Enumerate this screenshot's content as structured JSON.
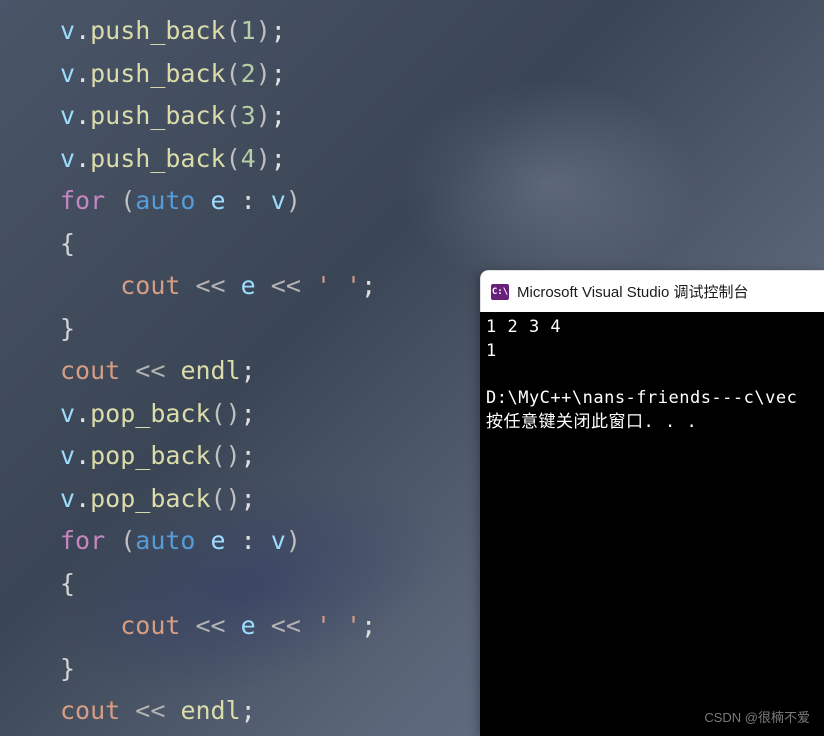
{
  "code": {
    "lines": [
      {
        "tokens": [
          {
            "t": "v",
            "c": "c-var"
          },
          {
            "t": ".",
            "c": "c-dot"
          },
          {
            "t": "push_back",
            "c": "c-method"
          },
          {
            "t": "(",
            "c": "c-paren"
          },
          {
            "t": "1",
            "c": "c-num"
          },
          {
            "t": ")",
            "c": "c-paren"
          },
          {
            "t": ";",
            "c": "c-semi"
          }
        ]
      },
      {
        "tokens": [
          {
            "t": "v",
            "c": "c-var"
          },
          {
            "t": ".",
            "c": "c-dot"
          },
          {
            "t": "push_back",
            "c": "c-method"
          },
          {
            "t": "(",
            "c": "c-paren"
          },
          {
            "t": "2",
            "c": "c-num"
          },
          {
            "t": ")",
            "c": "c-paren"
          },
          {
            "t": ";",
            "c": "c-semi"
          }
        ]
      },
      {
        "tokens": [
          {
            "t": "v",
            "c": "c-var"
          },
          {
            "t": ".",
            "c": "c-dot"
          },
          {
            "t": "push_back",
            "c": "c-method"
          },
          {
            "t": "(",
            "c": "c-paren"
          },
          {
            "t": "3",
            "c": "c-num"
          },
          {
            "t": ")",
            "c": "c-paren"
          },
          {
            "t": ";",
            "c": "c-semi"
          }
        ]
      },
      {
        "tokens": [
          {
            "t": "v",
            "c": "c-var"
          },
          {
            "t": ".",
            "c": "c-dot"
          },
          {
            "t": "push_back",
            "c": "c-method"
          },
          {
            "t": "(",
            "c": "c-paren"
          },
          {
            "t": "4",
            "c": "c-num"
          },
          {
            "t": ")",
            "c": "c-paren"
          },
          {
            "t": ";",
            "c": "c-semi"
          }
        ]
      },
      {
        "tokens": [
          {
            "t": "for ",
            "c": "c-keyword"
          },
          {
            "t": "(",
            "c": "c-paren"
          },
          {
            "t": "auto ",
            "c": "c-type"
          },
          {
            "t": "e",
            "c": "c-var"
          },
          {
            "t": " : ",
            "c": "c-colon"
          },
          {
            "t": "v",
            "c": "c-var"
          },
          {
            "t": ")",
            "c": "c-paren"
          }
        ]
      },
      {
        "tokens": [
          {
            "t": "{",
            "c": "c-brace"
          }
        ]
      },
      {
        "tokens": [
          {
            "t": "    ",
            "c": ""
          },
          {
            "t": "cout",
            "c": "c-cout"
          },
          {
            "t": " << ",
            "c": "c-op"
          },
          {
            "t": "e",
            "c": "c-var"
          },
          {
            "t": " << ",
            "c": "c-op"
          },
          {
            "t": "' '",
            "c": "c-char"
          },
          {
            "t": ";",
            "c": "c-semi"
          }
        ]
      },
      {
        "tokens": [
          {
            "t": "}",
            "c": "c-brace"
          }
        ]
      },
      {
        "tokens": [
          {
            "t": "cout",
            "c": "c-cout"
          },
          {
            "t": " << ",
            "c": "c-op"
          },
          {
            "t": "endl",
            "c": "c-endl"
          },
          {
            "t": ";",
            "c": "c-semi"
          }
        ]
      },
      {
        "tokens": [
          {
            "t": "v",
            "c": "c-var"
          },
          {
            "t": ".",
            "c": "c-dot"
          },
          {
            "t": "pop_back",
            "c": "c-method"
          },
          {
            "t": "()",
            "c": "c-paren"
          },
          {
            "t": ";",
            "c": "c-semi"
          }
        ]
      },
      {
        "tokens": [
          {
            "t": "v",
            "c": "c-var"
          },
          {
            "t": ".",
            "c": "c-dot"
          },
          {
            "t": "pop_back",
            "c": "c-method"
          },
          {
            "t": "()",
            "c": "c-paren"
          },
          {
            "t": ";",
            "c": "c-semi"
          }
        ]
      },
      {
        "tokens": [
          {
            "t": "v",
            "c": "c-var"
          },
          {
            "t": ".",
            "c": "c-dot"
          },
          {
            "t": "pop_back",
            "c": "c-method"
          },
          {
            "t": "()",
            "c": "c-paren"
          },
          {
            "t": ";",
            "c": "c-semi"
          }
        ]
      },
      {
        "tokens": [
          {
            "t": "for ",
            "c": "c-keyword"
          },
          {
            "t": "(",
            "c": "c-paren"
          },
          {
            "t": "auto ",
            "c": "c-type"
          },
          {
            "t": "e",
            "c": "c-var"
          },
          {
            "t": " : ",
            "c": "c-colon"
          },
          {
            "t": "v",
            "c": "c-var"
          },
          {
            "t": ")",
            "c": "c-paren"
          }
        ]
      },
      {
        "tokens": [
          {
            "t": "{",
            "c": "c-brace"
          }
        ]
      },
      {
        "tokens": [
          {
            "t": "    ",
            "c": ""
          },
          {
            "t": "cout",
            "c": "c-cout"
          },
          {
            "t": " << ",
            "c": "c-op"
          },
          {
            "t": "e",
            "c": "c-var"
          },
          {
            "t": " << ",
            "c": "c-op"
          },
          {
            "t": "' '",
            "c": "c-char"
          },
          {
            "t": ";",
            "c": "c-semi"
          }
        ]
      },
      {
        "tokens": [
          {
            "t": "}",
            "c": "c-brace"
          }
        ]
      },
      {
        "tokens": [
          {
            "t": "cout",
            "c": "c-cout"
          },
          {
            "t": " << ",
            "c": "c-op"
          },
          {
            "t": "endl",
            "c": "c-endl"
          },
          {
            "t": ";",
            "c": "c-semi"
          }
        ]
      }
    ]
  },
  "console": {
    "icon_text": "C:\\",
    "title": "Microsoft Visual Studio 调试控制台",
    "output": "1 2 3 4\n1\n\nD:\\MyC++\\nans-friends---c\\vec\n按任意键关闭此窗口. . ."
  },
  "watermark": "CSDN @很楠不爱"
}
